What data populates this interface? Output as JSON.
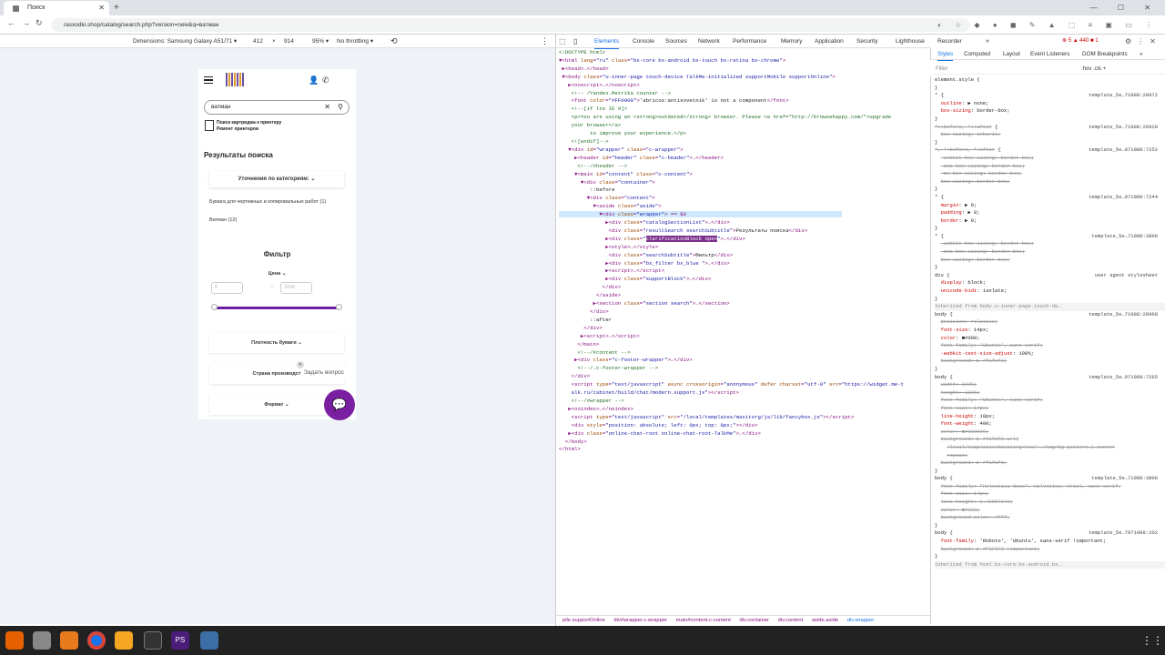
{
  "browser": {
    "tab_title": "Поиск",
    "new_tab": "+",
    "url": "rasxodki.shop/catalog/search.php?version=new&q=ватман",
    "window_controls": "— ☐ ✕"
  },
  "device_toolbar": {
    "dimensions_label": "Dimensions: Samsung Galaxy A51/71 ▾",
    "width": "412",
    "x": "×",
    "height": "914",
    "zoom": "95% ▾",
    "throttle": "No throttling ▾"
  },
  "page": {
    "search_value": "ватман",
    "suggestion_1": "Поиск картриджа к принтеру",
    "suggestion_2": "Ремонт принтеров",
    "results_title": "Результаты поиска",
    "refine_label": "Уточнения по категориям:",
    "category_1": "Бумага для чертежных и копировальных работ (1)",
    "category_2": "Ватман (12)",
    "filter_title": "Фильтр",
    "price_label": "Цена",
    "price_min_placeholder": "6",
    "price_max_placeholder": "1896",
    "price_dash": "–",
    "density_label": "Плотность бумаги",
    "country_label": "Страна производст",
    "format_label": "Формат",
    "ask_question": "Задать вопрос"
  },
  "devtools": {
    "tabs": [
      "Elements",
      "Console",
      "Sources",
      "Network",
      "Performance",
      "Memory",
      "Application",
      "Security",
      "Lighthouse",
      "Recorder",
      "»"
    ],
    "counters": "⊗ 5  ▲ 440  ■ 1",
    "style_tabs": [
      "Styles",
      "Computed",
      "Layout",
      "Event Listeners",
      "DOM Breakpoints",
      "»"
    ],
    "filter_placeholder": "Filter",
    "filter_right": ":hov .cls  +",
    "breadcrumbs": [
      "pile.supportOnline",
      "div#wrapper.c-wrapper",
      "main#content.c-content",
      "div.container",
      "div.content",
      "aside.aside",
      "div.wrapper"
    ]
  },
  "colors": {
    "accent": "#6b1fa7",
    "chat": "#7b1fa2",
    "devtools_blue": "#1a73e8"
  }
}
